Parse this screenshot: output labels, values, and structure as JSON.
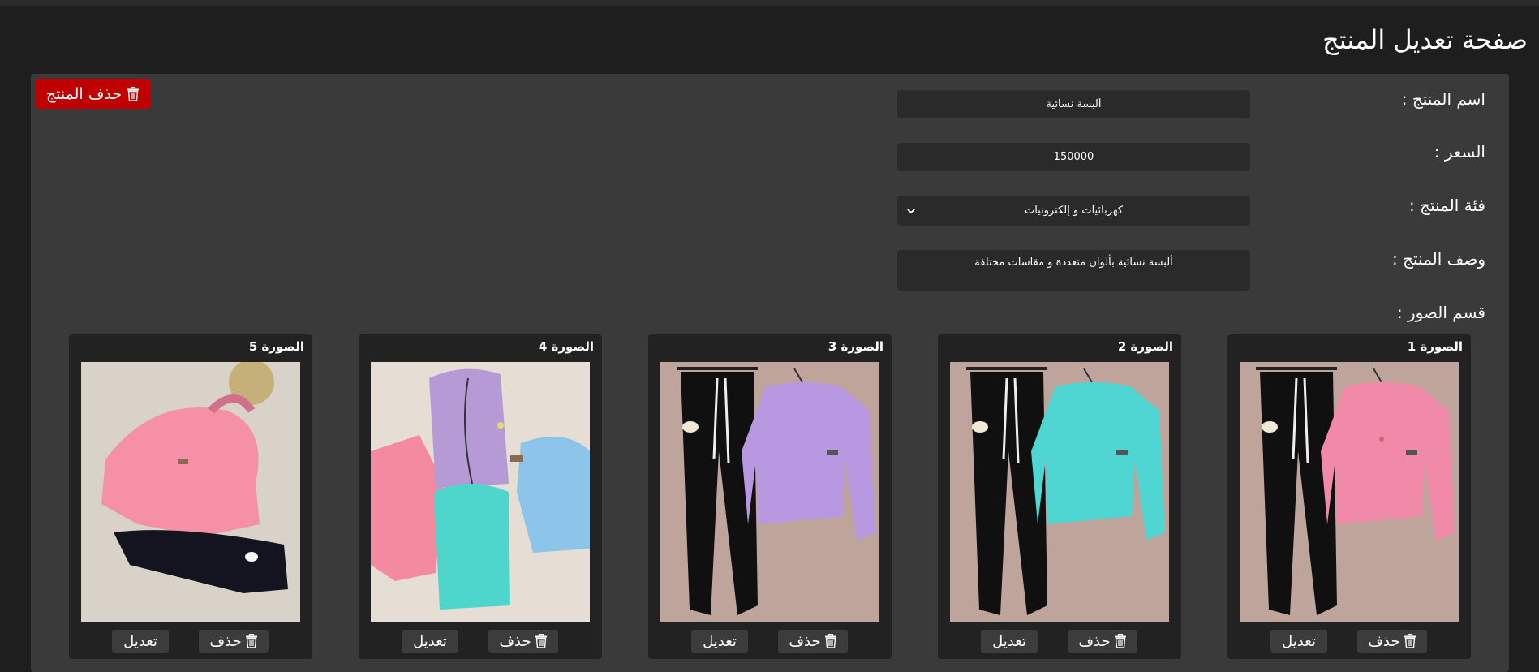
{
  "page": {
    "title": "صفحة تعديل المنتج"
  },
  "actions": {
    "delete_product": "حذف المنتج"
  },
  "form": {
    "name": {
      "label": "اسم المنتج :",
      "value": "ألبسة نسائية"
    },
    "price": {
      "label": "السعر :",
      "value": "150000"
    },
    "category": {
      "label": "فئة المنتج :",
      "value": "كهربائيات و إلكترونيات"
    },
    "description": {
      "label": "وصف المنتج :",
      "value": "ألبسة نسائية بألوان متعددة و مقاسات مختلفة"
    }
  },
  "images_section": {
    "label": "قسم الصور :",
    "cards": [
      {
        "label": "الصورة 1",
        "delete": "حذف",
        "edit": "تعديل",
        "color": "#f08aa8"
      },
      {
        "label": "الصورة 2",
        "delete": "حذف",
        "edit": "تعديل",
        "color": "#4fd6d2"
      },
      {
        "label": "الصورة 3",
        "delete": "حذف",
        "edit": "تعديل",
        "color": "#b898e0"
      },
      {
        "label": "الصورة 4",
        "delete": "حذف",
        "edit": "تعديل",
        "color": "#b59ad6"
      },
      {
        "label": "الصورة 5",
        "delete": "حذف",
        "edit": "تعديل",
        "color": "#f590a6"
      }
    ]
  },
  "colors": {
    "background": "#1e1e1e",
    "panel": "#3a3a3a",
    "field": "#2a2a2a",
    "card": "#222222",
    "danger": "#c00000"
  }
}
